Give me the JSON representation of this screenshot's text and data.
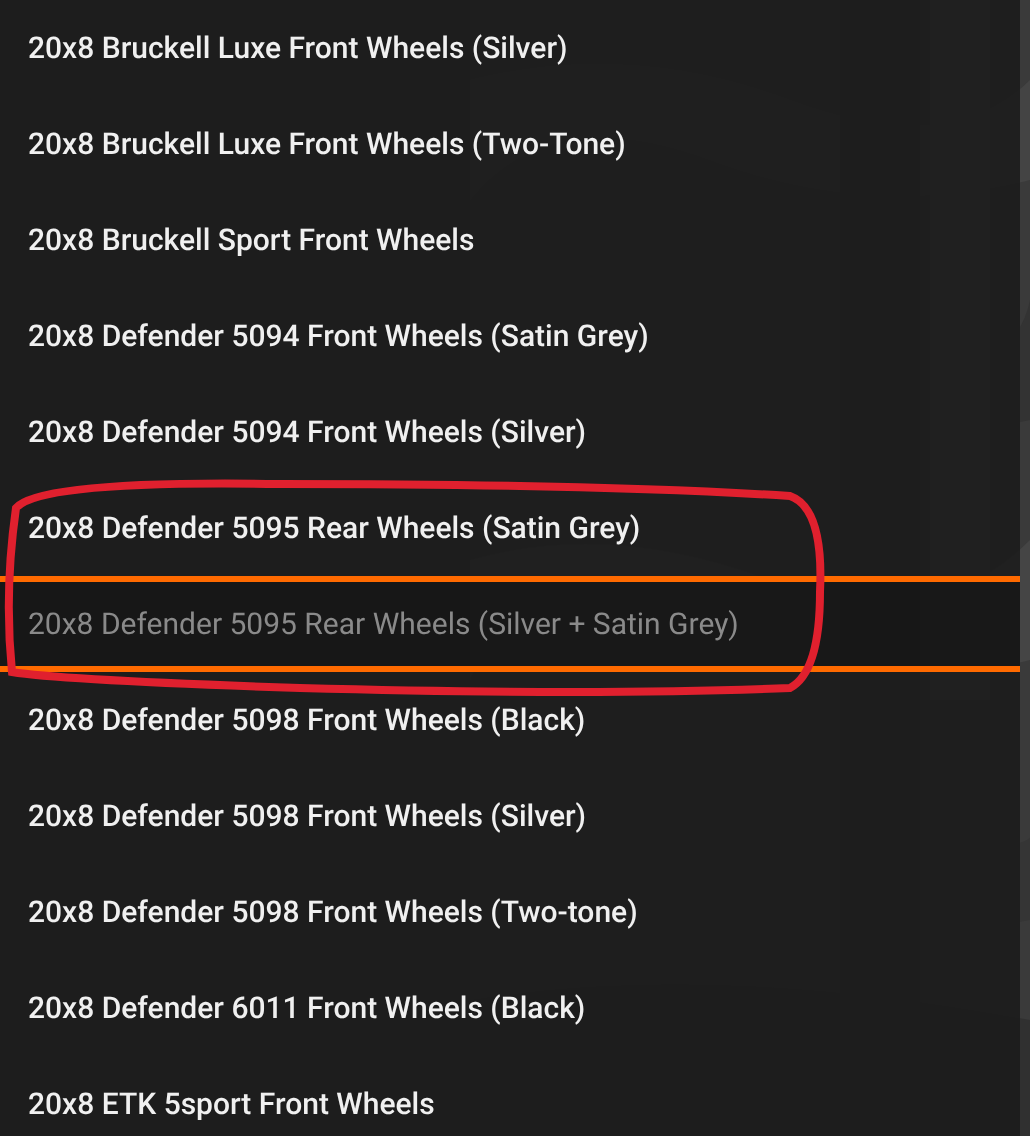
{
  "dropdown": {
    "options": [
      {
        "label": "20x8 Bruckell Luxe Front Wheels (Silver)",
        "selected": false
      },
      {
        "label": "20x8 Bruckell Luxe Front Wheels (Two-Tone)",
        "selected": false
      },
      {
        "label": "20x8 Bruckell Sport Front Wheels",
        "selected": false
      },
      {
        "label": "20x8 Defender 5094 Front Wheels (Satin Grey)",
        "selected": false
      },
      {
        "label": "20x8 Defender 5094 Front Wheels (Silver)",
        "selected": false
      },
      {
        "label": "20x8 Defender 5095 Rear Wheels (Satin Grey)",
        "selected": false
      },
      {
        "label": "20x8 Defender 5095 Rear Wheels (Silver + Satin Grey)",
        "selected": true
      },
      {
        "label": "20x8 Defender 5098 Front Wheels (Black)",
        "selected": false
      },
      {
        "label": "20x8 Defender 5098 Front Wheels (Silver)",
        "selected": false
      },
      {
        "label": "20x8 Defender 5098 Front Wheels (Two-tone)",
        "selected": false
      },
      {
        "label": "20x8 Defender 6011 Front Wheels (Black)",
        "selected": false
      },
      {
        "label": "20x8 ETK 5sport Front Wheels",
        "selected": false
      }
    ]
  }
}
